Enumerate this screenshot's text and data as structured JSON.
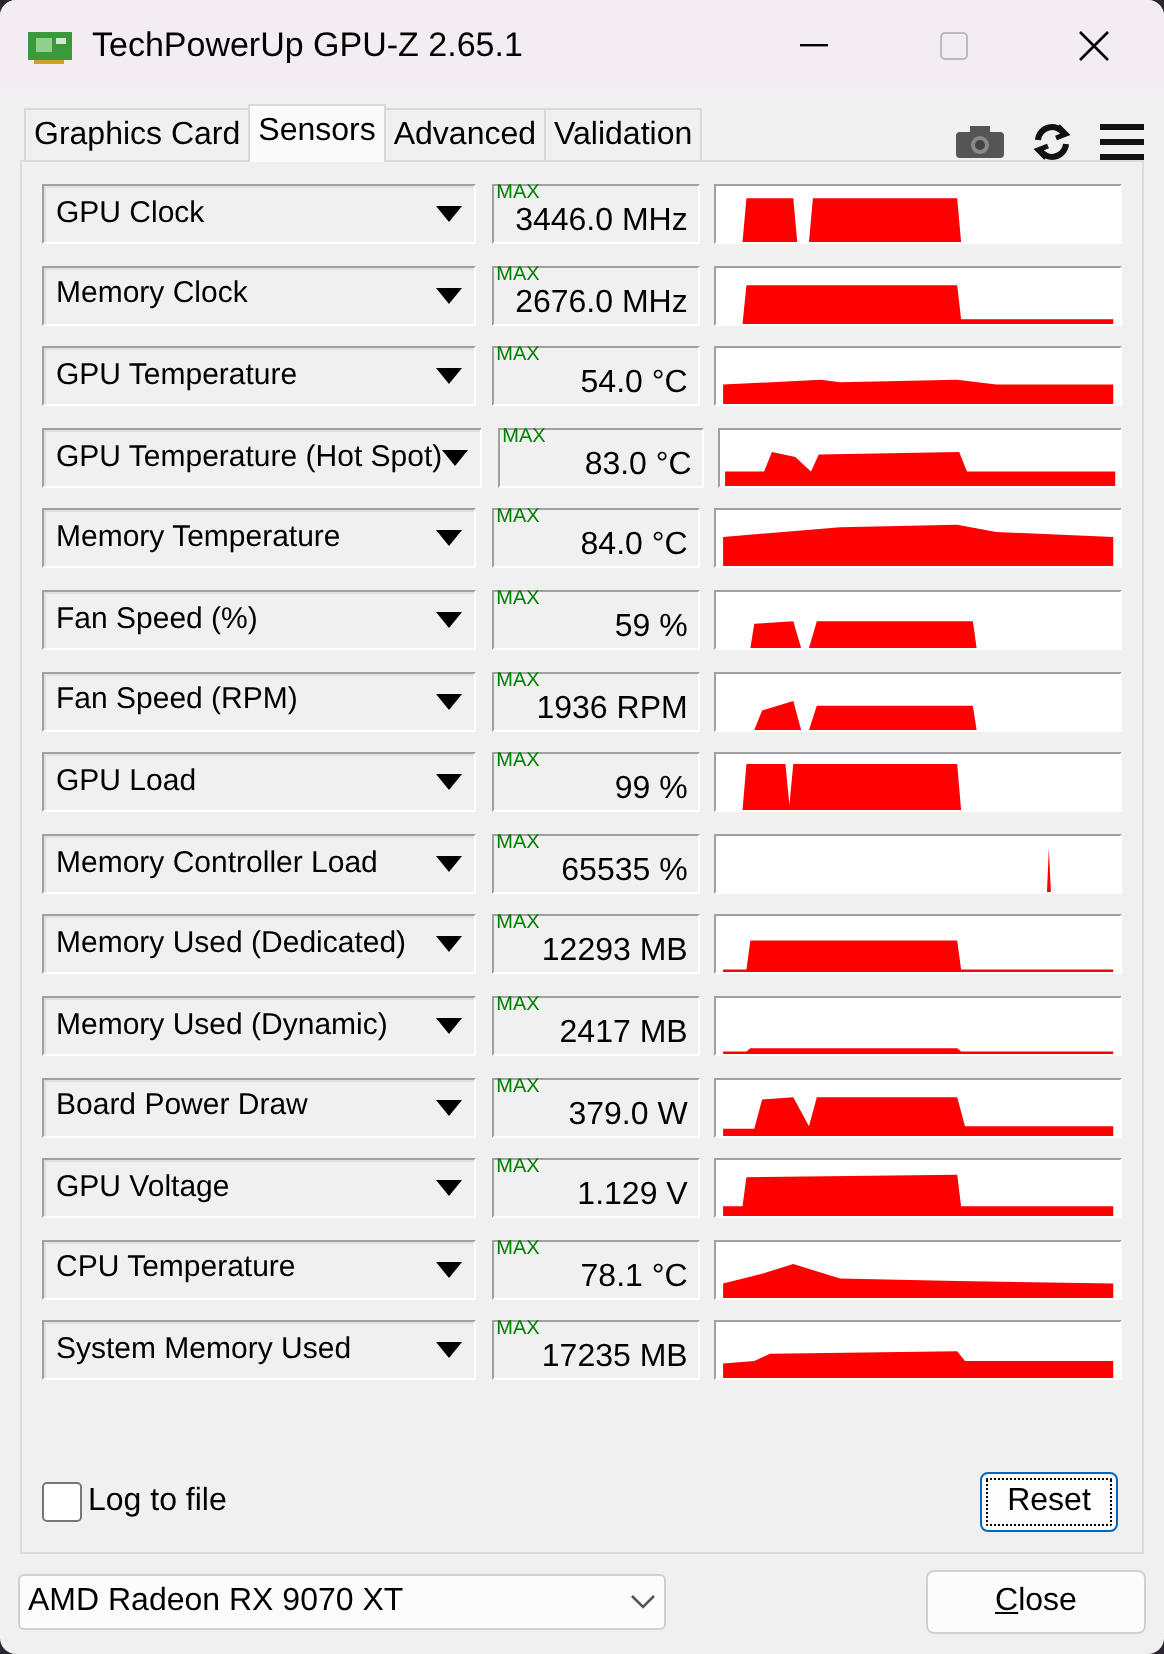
{
  "window": {
    "title": "TechPowerUp GPU-Z 2.65.1"
  },
  "tabs": [
    {
      "label": "Graphics Card",
      "selected": false
    },
    {
      "label": "Sensors",
      "selected": true
    },
    {
      "label": "Advanced",
      "selected": false
    },
    {
      "label": "Validation",
      "selected": false
    }
  ],
  "sensors": [
    {
      "name": "GPU Clock",
      "max_label": "MAX",
      "value": "3446.0 MHz"
    },
    {
      "name": "Memory Clock",
      "max_label": "MAX",
      "value": "2676.0 MHz"
    },
    {
      "name": "GPU Temperature",
      "max_label": "MAX",
      "value": "54.0 °C"
    },
    {
      "name": "GPU Temperature (Hot Spot)",
      "max_label": "MAX",
      "value": "83.0 °C"
    },
    {
      "name": "Memory Temperature",
      "max_label": "MAX",
      "value": "84.0 °C"
    },
    {
      "name": "Fan Speed (%)",
      "max_label": "MAX",
      "value": "59 %"
    },
    {
      "name": "Fan Speed (RPM)",
      "max_label": "MAX",
      "value": "1936 RPM"
    },
    {
      "name": "GPU Load",
      "max_label": "MAX",
      "value": "99 %"
    },
    {
      "name": "Memory Controller Load",
      "max_label": "MAX",
      "value": "65535 %"
    },
    {
      "name": "Memory Used (Dedicated)",
      "max_label": "MAX",
      "value": "12293 MB"
    },
    {
      "name": "Memory Used (Dynamic)",
      "max_label": "MAX",
      "value": "2417 MB"
    },
    {
      "name": "Board Power Draw",
      "max_label": "MAX",
      "value": "379.0 W"
    },
    {
      "name": "GPU Voltage",
      "max_label": "MAX",
      "value": "1.129 V"
    },
    {
      "name": "CPU Temperature",
      "max_label": "MAX",
      "value": "78.1 °C"
    },
    {
      "name": "System Memory Used",
      "max_label": "MAX",
      "value": "17235 MB"
    }
  ],
  "log_to_file": {
    "label": "Log to file",
    "checked": false
  },
  "reset_button": "Reset",
  "gpu_select": {
    "value": "AMD Radeon RX 9070 XT"
  },
  "close_button": "Close"
}
